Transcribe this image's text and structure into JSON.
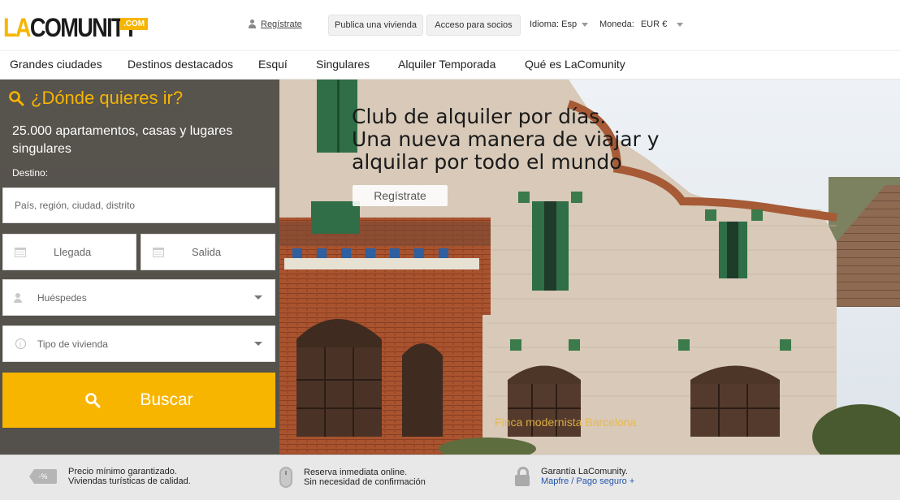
{
  "brand": {
    "logo_main": "COMUNITY",
    "logo_prefix": "LA",
    "logo_suffix": ".COM"
  },
  "top": {
    "register": "Regístrate",
    "publica": "Publica una vivienda",
    "acceso": "Acceso para socios",
    "idioma_label": "Idioma: Esp",
    "moneda_label": "Moneda:",
    "moneda_value": "EUR €"
  },
  "nav": [
    "Grandes ciudades",
    "Destinos destacados",
    "Esquí",
    "Singulares",
    "Alquiler Temporada",
    "Qué es LaComunity"
  ],
  "hero": {
    "headline_1": "Club de alquiler por días.",
    "headline_2": "Una nueva manera de viajar y",
    "headline_3": "alquilar por todo el mundo",
    "register_button": "Regístrate",
    "caption": "Finca modernista Barcelona"
  },
  "search": {
    "title": "¿Dónde quieres ir?",
    "subtitle": "25.000 apartamentos, casas y lugares singulares",
    "destino_label": "Destino:",
    "destino_placeholder": "País, región, ciudad, distrito",
    "llegada": "Llegada",
    "salida": "Salida",
    "huespedes": "Huéspedes",
    "tipo": "Tipo de vivienda",
    "buscar": "Buscar"
  },
  "features": [
    {
      "line1": "Precio mínimo garantizado.",
      "line2": "Viviendas turísticas de calidad.",
      "icon": "price-tag-icon",
      "icon_text": "-%"
    },
    {
      "line1": "Reserva inmediata online.",
      "line2": "Sin necesidad de confirmación",
      "icon": "mouse-icon"
    },
    {
      "line1": "Garantía LaComunity.",
      "line2": "Mapfre / Pago seguro +",
      "icon": "lock-icon"
    }
  ],
  "colors": {
    "accent": "#f7b500",
    "link": "#2255aa"
  }
}
